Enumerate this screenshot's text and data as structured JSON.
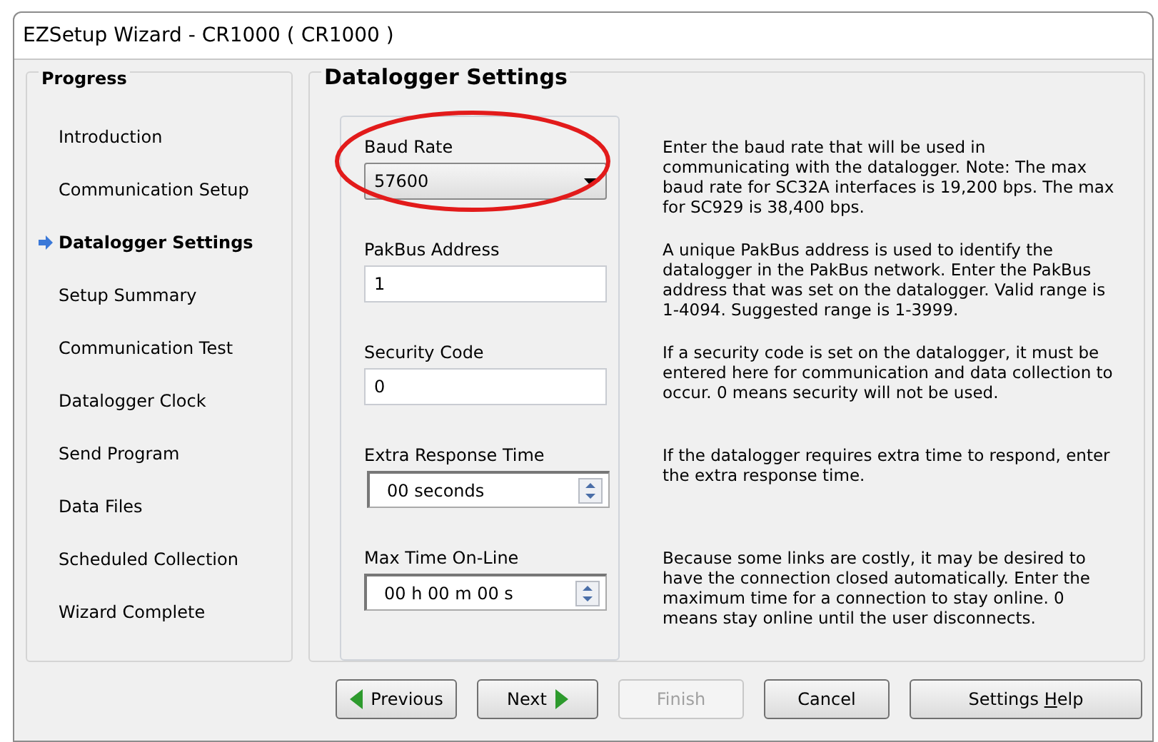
{
  "window": {
    "title": "EZSetup Wizard - CR1000 ( CR1000 )"
  },
  "progress": {
    "title": "Progress",
    "steps": [
      {
        "label": "Introduction",
        "selected": false
      },
      {
        "label": "Communication Setup",
        "selected": false
      },
      {
        "label": "Datalogger Settings",
        "selected": true
      },
      {
        "label": "Setup Summary",
        "selected": false
      },
      {
        "label": "Communication Test",
        "selected": false
      },
      {
        "label": "Datalogger Clock",
        "selected": false
      },
      {
        "label": "Send Program",
        "selected": false
      },
      {
        "label": "Data Files",
        "selected": false
      },
      {
        "label": "Scheduled Collection",
        "selected": false
      },
      {
        "label": "Wizard Complete",
        "selected": false
      }
    ]
  },
  "page": {
    "title": "Datalogger Settings",
    "fields": [
      {
        "kind": "dropdown",
        "label": "Baud Rate",
        "value": "57600",
        "circled": true,
        "description": "Enter the baud rate that will be used in communicating with the datalogger. Note: The max baud rate for SC32A interfaces is 19,200 bps.  The max for SC929 is 38,400 bps."
      },
      {
        "kind": "text",
        "label": "PakBus Address",
        "value": "1",
        "circled": false,
        "description": "A unique PakBus address is used to identify the datalogger in the PakBus network.  Enter the PakBus address that was set on the datalogger.  Valid range is 1-4094.  Suggested range is 1-3999."
      },
      {
        "kind": "text",
        "label": "Security Code",
        "value": "0",
        "circled": false,
        "description": "If a security code is set on the datalogger, it must be entered here for communication and data collection to occur.  0 means security will not be used."
      },
      {
        "kind": "spin",
        "label": "Extra Response Time",
        "value": "00 seconds",
        "circled": false,
        "description": "If the datalogger requires extra time to respond, enter the extra response time."
      },
      {
        "kind": "spin",
        "label": "Max Time On-Line",
        "value": "00 h 00 m 00 s",
        "circled": false,
        "description": "Because some links are costly, it may be desired to have the connection closed automatically.  Enter the maximum time for a connection to stay online.  0 means stay online until the user disconnects."
      }
    ]
  },
  "buttons": [
    {
      "kind": "previous",
      "label": "Previous",
      "disabled": false
    },
    {
      "kind": "next",
      "label": "Next",
      "disabled": false
    },
    {
      "kind": "plain",
      "label": "Finish",
      "disabled": true
    },
    {
      "kind": "plain",
      "label": "Cancel",
      "disabled": false
    },
    {
      "kind": "help",
      "label_before": "Settings ",
      "accelerator": "H",
      "label_after": "elp",
      "disabled": false
    }
  ]
}
